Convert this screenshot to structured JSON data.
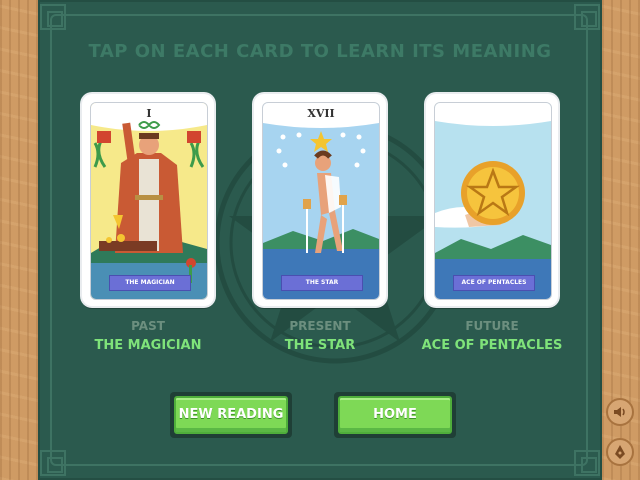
{
  "instruction": "TAP ON EACH CARD TO LEARN ITS MEANING",
  "cards": [
    {
      "numeral": "I",
      "banner": "THE MAGICIAN",
      "position": "PAST",
      "name": "THE MAGICIAN"
    },
    {
      "numeral": "XVII",
      "banner": "THE STAR",
      "position": "PRESENT",
      "name": "THE STAR"
    },
    {
      "numeral": "",
      "banner": "ACE OF PENTACLES",
      "position": "FUTURE",
      "name": "ACE OF PENTACLES"
    }
  ],
  "buttons": {
    "new_reading": "NEW READING",
    "home": "HOME"
  },
  "side_icons": [
    "speaker-icon",
    "pen-nib-icon"
  ],
  "colors": {
    "board": "#2b5a4e",
    "card_name": "#7fe37a",
    "position_label": "#6c8f7f",
    "button": "#7ed956",
    "banner": "#6b6fd6"
  }
}
